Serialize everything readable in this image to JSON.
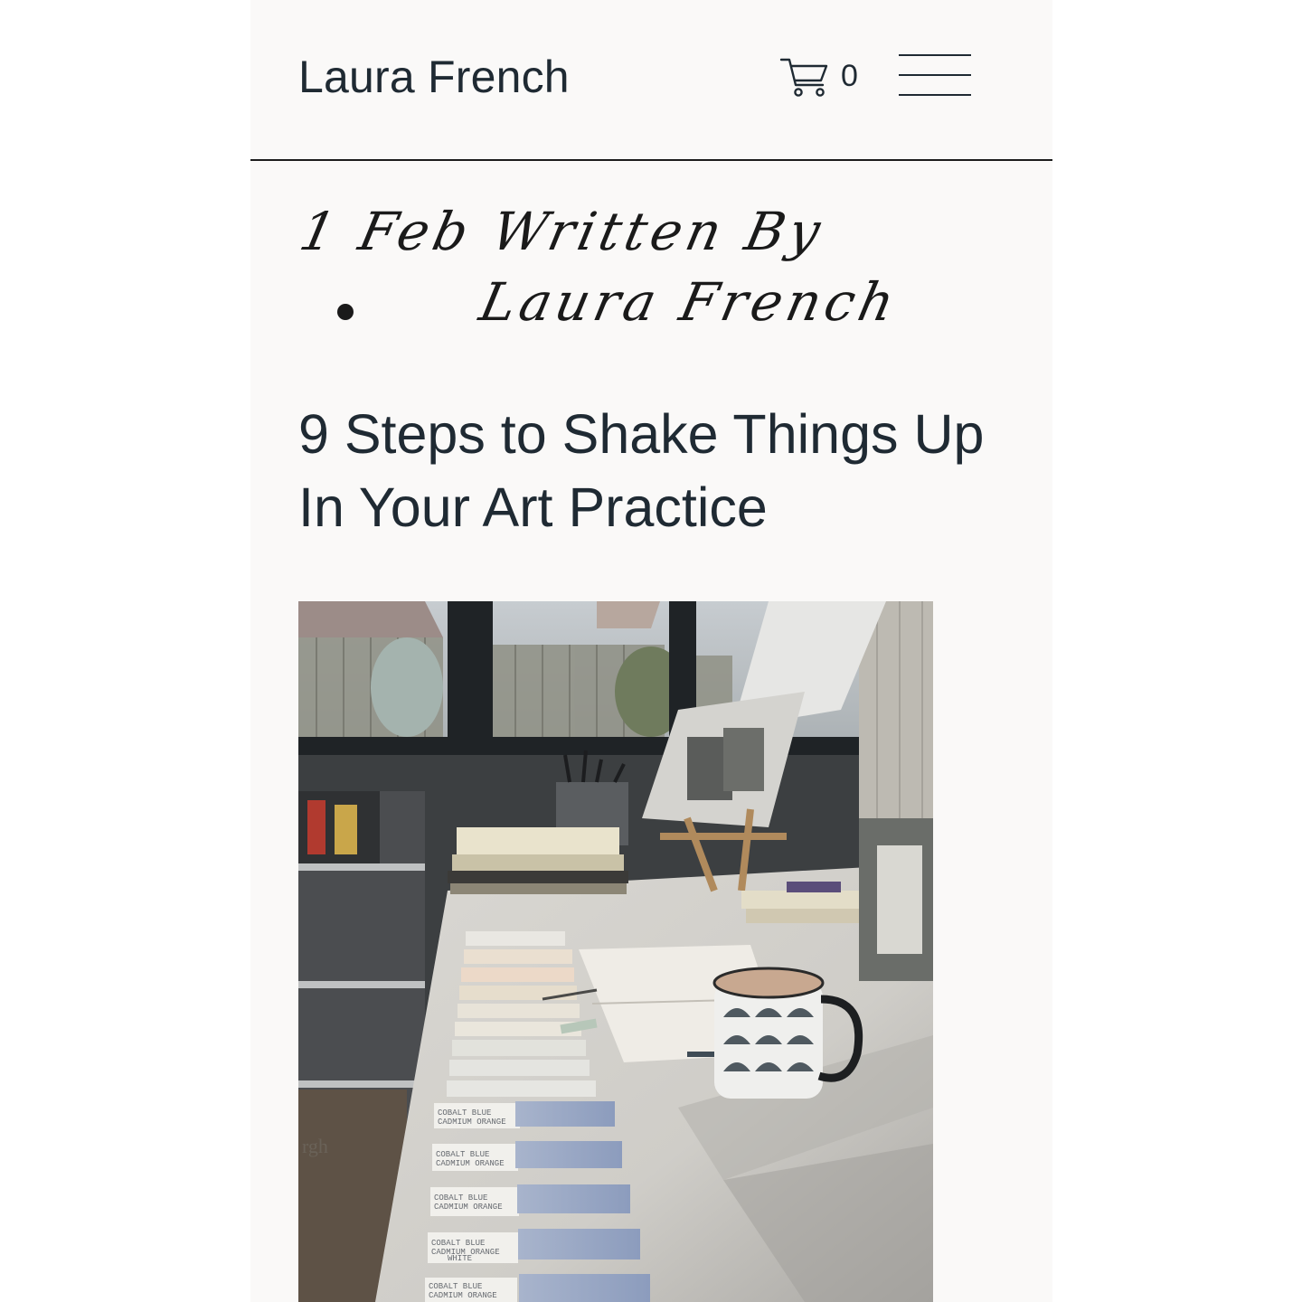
{
  "header": {
    "site_title": "Laura French",
    "cart_count": "0",
    "cart_icon": "cart-icon",
    "menu_icon": "hamburger-menu-icon"
  },
  "post": {
    "date": "1 Feb",
    "written_by": "Written By",
    "author": "Laura French",
    "title": "9 Steps to Shake Things Up In Your Art Practice",
    "hero_image": {
      "swatch_labels": [
        "COBALT BLUE",
        "CADMIUM ORANGE",
        "WHITE"
      ],
      "bag_text": "rgh"
    }
  },
  "colors": {
    "page_background": "#ffffff",
    "app_background": "#faf9f8",
    "text": "#1f2a33",
    "divider": "#1c1c1c"
  }
}
